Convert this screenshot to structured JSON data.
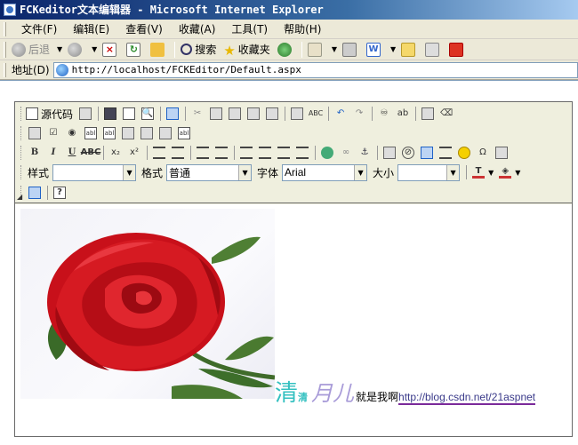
{
  "window": {
    "title": "FCKeditor文本编辑器 - Microsoft Internet Explorer"
  },
  "menu": [
    "文件(F)",
    "编辑(E)",
    "查看(V)",
    "收藏(A)",
    "工具(T)",
    "帮助(H)"
  ],
  "toolbar": {
    "back_label": "后退",
    "search_label": "搜索",
    "favorites_label": "收藏夹"
  },
  "address": {
    "label": "地址(D)",
    "url": "http://localhost/FCKEditor/Default.aspx"
  },
  "editor": {
    "source_label": "源代码",
    "style_label": "样式",
    "style_value": "",
    "format_label": "格式",
    "format_value": "普通",
    "font_label": "字体",
    "font_value": "Arial",
    "size_label": "大小",
    "size_value": ""
  },
  "content": {
    "big_char": "清",
    "small_char": "清",
    "script_text": "月儿",
    "plain_text": "就是我啊",
    "link_text": "http://blog.csdn.net/21aspnet"
  }
}
